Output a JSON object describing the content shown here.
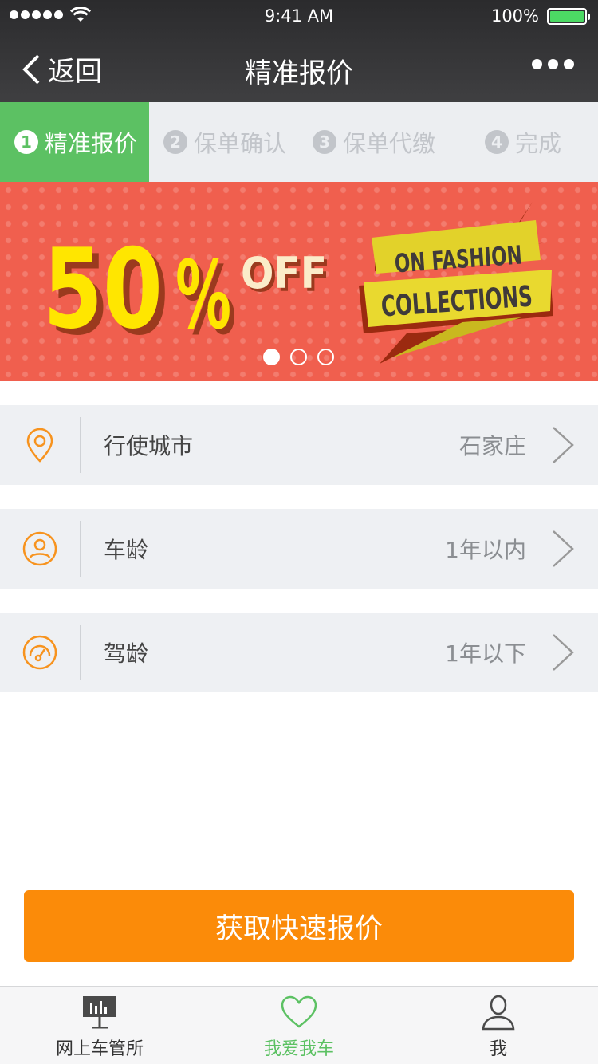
{
  "status_bar": {
    "time": "9:41 AM",
    "battery": "100%",
    "battery_color": "#4cd964"
  },
  "nav": {
    "back_label": "返回",
    "title": "精准报价"
  },
  "steps": [
    {
      "num": "1",
      "label": "精准报价",
      "active": true
    },
    {
      "num": "2",
      "label": "保单确认",
      "active": false
    },
    {
      "num": "3",
      "label": "保单代缴",
      "active": false
    },
    {
      "num": "4",
      "label": "完成",
      "active": false
    }
  ],
  "banner": {
    "discount": "50",
    "percent": "%",
    "off": "OFF",
    "ribbon_line1": "ON FASHION",
    "ribbon_line2": "COLLECTIONS",
    "current_slide": 1,
    "slide_count": 3
  },
  "form": {
    "rows": [
      {
        "icon": "location-pin-icon",
        "label": "行使城市",
        "value": "石家庄"
      },
      {
        "icon": "person-icon",
        "label": "车龄",
        "value": "1年以内"
      },
      {
        "icon": "speedometer-icon",
        "label": "驾龄",
        "value": "1年以下"
      }
    ]
  },
  "cta": {
    "label": "获取快速报价"
  },
  "tabbar": {
    "items": [
      {
        "icon": "dashboard-board-icon",
        "label": "网上车管所",
        "active": false
      },
      {
        "icon": "heart-icon",
        "label": "我爱我车",
        "active": true
      },
      {
        "icon": "user-icon",
        "label": "我",
        "active": false
      }
    ]
  },
  "colors": {
    "accent_green": "#5cc163",
    "accent_orange": "#fb8b09",
    "banner_red": "#f05f4e",
    "icon_orange": "#f7931e"
  }
}
